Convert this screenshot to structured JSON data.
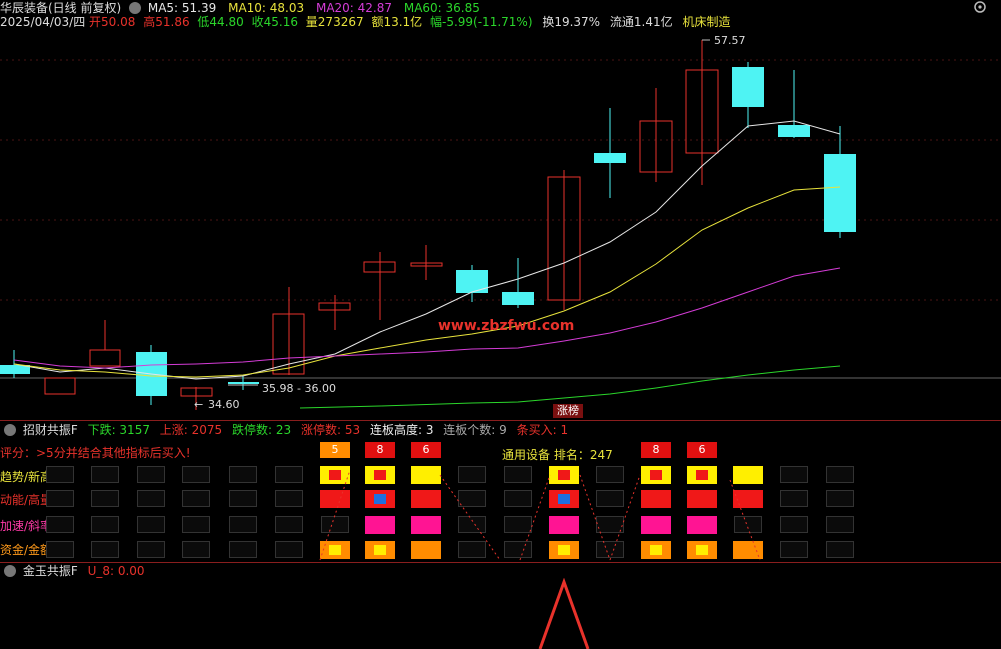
{
  "header": {
    "title": "华辰装备(日线 前复权)",
    "ma5": "MA5: 51.39",
    "ma10": "MA10: 48.03",
    "ma20": "MA20: 42.87",
    "ma60": "MA60: 36.85",
    "date": "2025/04/03/四",
    "open": "开50.08",
    "high": "高51.86",
    "low": "低44.80",
    "close": "收45.16",
    "volume": "量273267",
    "amount": "额13.1亿",
    "change": "幅-5.99(-11.71%)",
    "turnover": "换19.37%",
    "float": "流通1.41亿",
    "sector": "机床制造"
  },
  "main_chart": {
    "high_label": "57.57",
    "low_label": "34.60",
    "range_label": "35.98 - 36.00",
    "watermark": "www.zbzfwu.com",
    "limit_tag": "涨榜",
    "colors": {
      "up": "#e8322b",
      "down": "#4ef3f3",
      "ma5": "#e6e6e6",
      "ma10": "#e8e33c",
      "ma20": "#d43cd6",
      "ma60": "#2bd62b"
    }
  },
  "indicator1": {
    "name": "招财共振F",
    "down_count": "下跌: 3157",
    "up_count": "上涨: 2075",
    "limit_down": "跌停数: 23",
    "limit_up": "涨停数: 53",
    "board_height": "连板高度: 3",
    "board_count": "连板个数: 9",
    "buy_signal": "条买入: 1",
    "note": "评分：>5分并结合其他指标后买入!",
    "rank_label": "通用设备 排名：247",
    "rows": [
      "趋势/新高",
      "动能/高量",
      "加速/斜率",
      "资金/金额"
    ],
    "score_tags": [
      "5",
      "8",
      "6",
      "8",
      "6"
    ]
  },
  "indicator2": {
    "name": "金玉共振F",
    "value": "U_8: 0.00"
  }
}
